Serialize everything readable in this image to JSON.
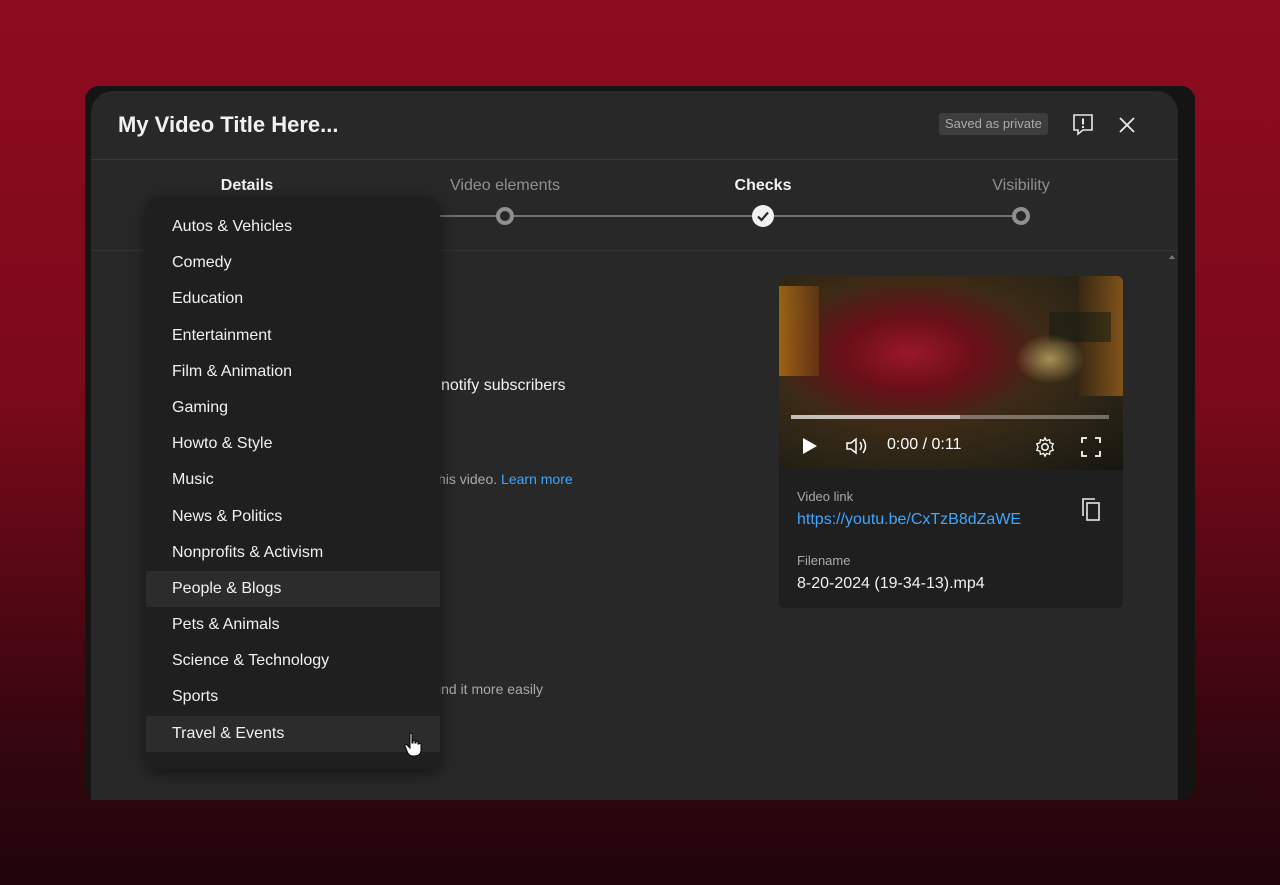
{
  "modal": {
    "title": "My Video Title Here...",
    "saved_badge": "Saved as private"
  },
  "stepper": {
    "steps": [
      {
        "label": "Details",
        "state": "active"
      },
      {
        "label": "Video elements",
        "state": "incomplete"
      },
      {
        "label": "Checks",
        "state": "complete"
      },
      {
        "label": "Visibility",
        "state": "incomplete"
      }
    ]
  },
  "background_content": {
    "notify_text": "notify subscribers",
    "video_text": "his video.",
    "learn_more": "Learn more",
    "find_text": "ind it more easily"
  },
  "preview": {
    "time": "0:00 / 0:11",
    "progress_fraction": 0.53,
    "video_link_label": "Video link",
    "video_link": "https://youtu.be/CxTzB8dZaWE",
    "filename_label": "Filename",
    "filename": "8-20-2024 (19-34-13).mp4"
  },
  "category_dropdown": {
    "items": [
      "Autos & Vehicles",
      "Comedy",
      "Education",
      "Entertainment",
      "Film & Animation",
      "Gaming",
      "Howto & Style",
      "Music",
      "News & Politics",
      "Nonprofits & Activism",
      "People & Blogs",
      "Pets & Animals",
      "Science & Technology",
      "Sports",
      "Travel & Events"
    ],
    "selected": "People & Blogs",
    "hovered": "Travel & Events"
  },
  "colors": {
    "accent_link": "#3ea6ff",
    "modal_bg": "#282828",
    "dropdown_bg": "#1f1f1f"
  }
}
